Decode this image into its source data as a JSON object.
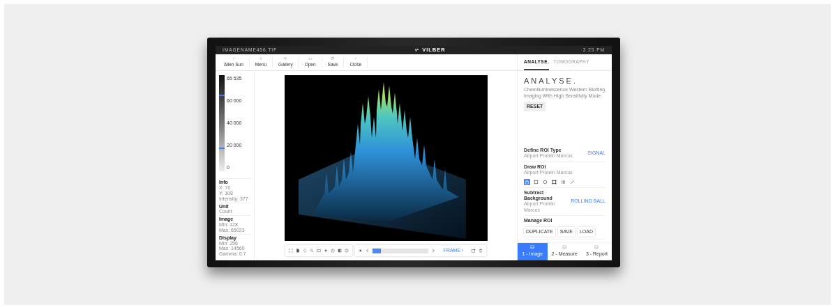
{
  "top_bar": {
    "file_name": "IMAGENAME456.TIF",
    "logo": "VILBER",
    "time": "3:25 PM"
  },
  "toolbar": [
    {
      "label": "Allen Sun"
    },
    {
      "label": "Menu"
    },
    {
      "label": "Gallery"
    },
    {
      "label": "Open"
    },
    {
      "label": "Save"
    },
    {
      "label": "Close"
    }
  ],
  "scale": {
    "labels": [
      "65 535",
      "60 000",
      "40 000",
      "20 000",
      "0"
    ],
    "markers": [
      {
        "level": 0.78
      },
      {
        "level": 0.235
      }
    ]
  },
  "info": [
    {
      "title": "Info",
      "lines": [
        "X: 70",
        "Y: 108",
        "Intensity: 377"
      ]
    },
    {
      "title": "Unit",
      "lines": [
        "Count"
      ]
    },
    {
      "title": "Image",
      "lines": [
        "Min: 128",
        "Max: 65023"
      ]
    },
    {
      "title": "Display",
      "lines": [
        "Min: 256",
        "Max: 14560",
        "Gamma: 0.7"
      ]
    }
  ],
  "timeline": {
    "level": 0.15,
    "frame_link": "FRAME ›"
  },
  "tabs": [
    {
      "label": "ANALYSE.",
      "selected": true
    },
    {
      "label": "TOMOGRAPHY",
      "selected": false
    }
  ],
  "panel": {
    "heading": "ANALYSE.",
    "description": "Chemiluminescence Western Blotting Imaging With High Sensitivity Mode",
    "reset": "RESET"
  },
  "sections": [
    {
      "kind": "action",
      "title": "Define ROI Type",
      "subtitle": "Airport Protein Marcus",
      "action": "SIGNAL"
    },
    {
      "kind": "tools",
      "title": "Draw ROI",
      "subtitle": "Airport Protein Marcus",
      "tools": [
        {
          "selected": true
        },
        {
          "selected": false
        },
        {
          "selected": false
        },
        {
          "selected": false
        },
        {
          "selected": false
        },
        {
          "selected": false
        }
      ]
    },
    {
      "kind": "action",
      "title": "Subtract Background",
      "subtitle": "Airport Protein Marcus",
      "action": "ROLLING BALL"
    },
    {
      "kind": "buttons",
      "title": "Manage ROI",
      "buttons": [
        "DUPLICATE",
        "SAVE",
        "LOAD"
      ]
    }
  ],
  "steps": [
    {
      "label": "1 - Image",
      "selected": true
    },
    {
      "label": "2 - Measure",
      "selected": false
    },
    {
      "label": "3 - Report",
      "selected": false
    }
  ]
}
